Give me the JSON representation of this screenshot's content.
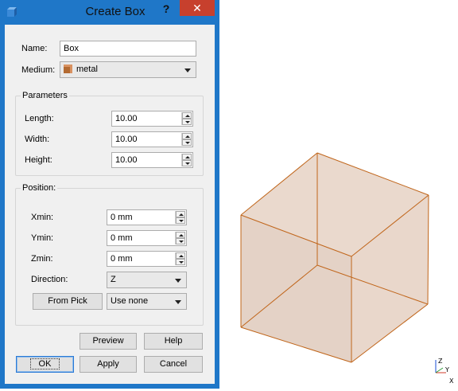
{
  "dialog": {
    "title": "Create Box",
    "help_label": "?",
    "close_label": "✕",
    "name_label": "Name:",
    "name_value": "Box",
    "medium_label": "Medium:",
    "medium_value": "metal",
    "parameters": {
      "title": "Parameters",
      "length_label": "Length:",
      "length_value": "10.00",
      "width_label": "Width:",
      "width_value": "10.00",
      "height_label": "Height:",
      "height_value": "10.00"
    },
    "position": {
      "title": "Position:",
      "xmin_label": "Xmin:",
      "xmin_value": "0 mm",
      "ymin_label": "Ymin:",
      "ymin_value": "0 mm",
      "zmin_label": "Zmin:",
      "zmin_value": "0 mm",
      "direction_label": "Direction:",
      "direction_value": "Z",
      "from_pick_label": "From Pick",
      "use_value": "Use none"
    },
    "buttons": {
      "preview": "Preview",
      "help": "Help",
      "ok": "OK",
      "apply": "Apply",
      "cancel": "Cancel"
    }
  },
  "viewport": {
    "axis_labels": {
      "z": "Z",
      "y": "Y",
      "x": "X"
    },
    "colors": {
      "cube_edge": "#c0651a",
      "cube_fill": "#e9d9cf",
      "title_bar": "#1f77c8",
      "close": "#c7402d"
    }
  }
}
